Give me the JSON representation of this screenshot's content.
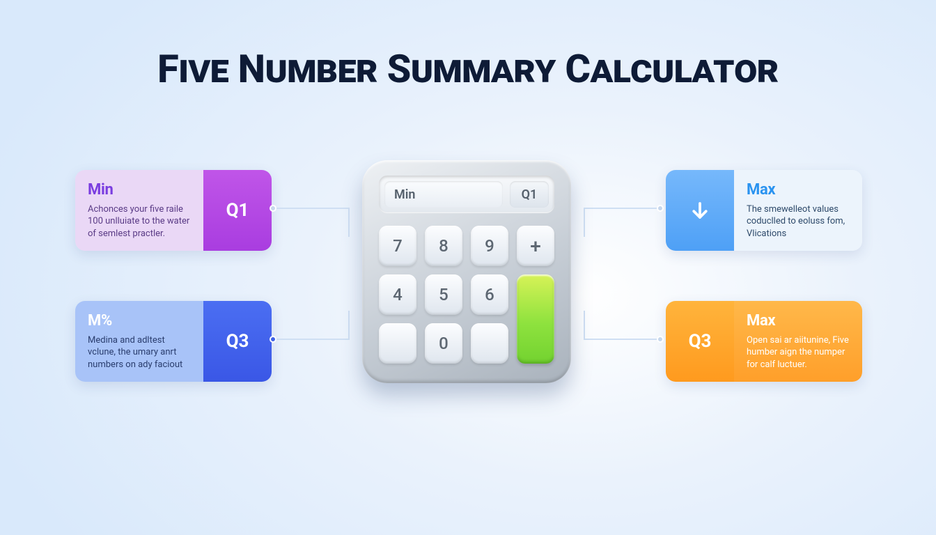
{
  "title": "Five Number Summary Calculator",
  "cards": {
    "left_top": {
      "title": "Min",
      "text": "Achonces your five raile 100 unlluiate to the water of semlest practler.",
      "badge": "Q1"
    },
    "left_bottom": {
      "title": "M%",
      "text": "Medina and adltest vclune, the umary anrt numbers on ady faciout",
      "badge": "Q3"
    },
    "right_top": {
      "title": "Max",
      "text": "The smewelleot values coduclled to eoluss fom, Vlications",
      "badge_icon": "arrow-down"
    },
    "right_bottom": {
      "title": "Max",
      "text": "Open sai ar aiitunine, Five humber aign the numper for calf luctuer.",
      "badge": "Q3"
    }
  },
  "calculator": {
    "screen_main": "Min",
    "screen_side": "Q1",
    "keys": {
      "k7": "7",
      "k8": "8",
      "k9": "9",
      "plus": "+",
      "k4": "4",
      "k5": "5",
      "k6": "6",
      "k0": "0"
    }
  }
}
